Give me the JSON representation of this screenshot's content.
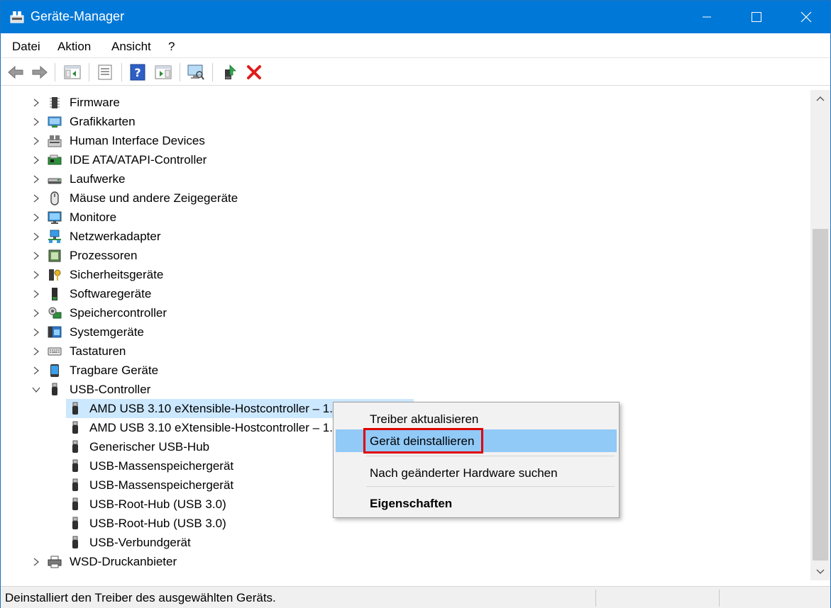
{
  "window": {
    "title": "Geräte-Manager"
  },
  "menu": {
    "items": [
      "Datei",
      "Aktion",
      "Ansicht",
      "?"
    ]
  },
  "tree": {
    "categories": [
      {
        "label": "Firmware",
        "icon": "firmware-icon"
      },
      {
        "label": "Grafikkarten",
        "icon": "display-adapter-icon"
      },
      {
        "label": "Human Interface Devices",
        "icon": "hid-icon"
      },
      {
        "label": "IDE ATA/ATAPI-Controller",
        "icon": "ide-controller-icon"
      },
      {
        "label": "Laufwerke",
        "icon": "disk-drive-icon"
      },
      {
        "label": "Mäuse und andere Zeigegeräte",
        "icon": "mouse-icon"
      },
      {
        "label": "Monitore",
        "icon": "monitor-icon"
      },
      {
        "label": "Netzwerkadapter",
        "icon": "network-adapter-icon"
      },
      {
        "label": "Prozessoren",
        "icon": "processor-icon"
      },
      {
        "label": "Sicherheitsgeräte",
        "icon": "security-device-icon"
      },
      {
        "label": "Softwaregeräte",
        "icon": "software-device-icon"
      },
      {
        "label": "Speichercontroller",
        "icon": "storage-controller-icon"
      },
      {
        "label": "Systemgeräte",
        "icon": "system-device-icon"
      },
      {
        "label": "Tastaturen",
        "icon": "keyboard-icon"
      },
      {
        "label": "Tragbare Geräte",
        "icon": "portable-device-icon"
      }
    ],
    "usb": {
      "label": "USB-Controller",
      "icon": "usb-icon",
      "children": [
        "AMD USB 3.10 eXtensible-Hostcontroller – 1.",
        "AMD USB 3.10 eXtensible-Hostcontroller – 1.",
        "Generischer USB-Hub",
        "USB-Massenspeichergerät",
        "USB-Massenspeichergerät",
        "USB-Root-Hub (USB 3.0)",
        "USB-Root-Hub (USB 3.0)",
        "USB-Verbundgerät"
      ]
    },
    "last": {
      "label": "WSD-Druckanbieter",
      "icon": "printer-icon"
    }
  },
  "context_menu": {
    "update_driver": "Treiber aktualisieren",
    "uninstall_device": "Gerät deinstallieren",
    "scan_hardware": "Nach geänderter Hardware suchen",
    "properties": "Eigenschaften"
  },
  "status": {
    "text": "Deinstalliert den Treiber des ausgewählten Geräts."
  },
  "colors": {
    "titlebar": "#0078d7",
    "selection": "#cce8ff",
    "menu_highlight": "#91c9f7",
    "annotation": "#e00000"
  }
}
